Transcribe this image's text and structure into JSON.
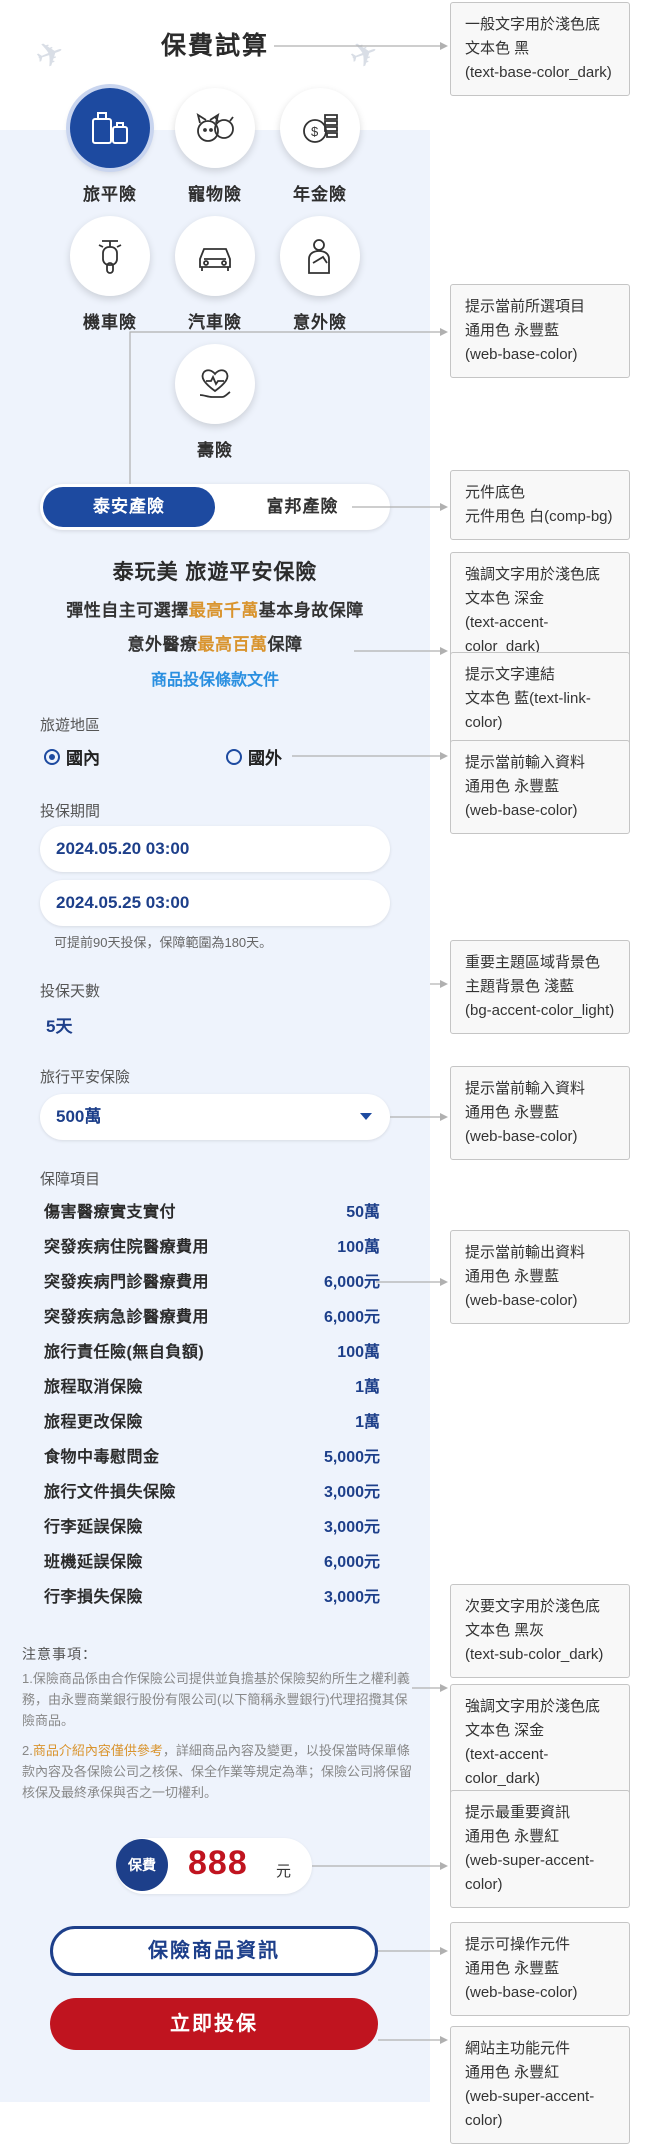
{
  "page": {
    "title": "保費試算"
  },
  "categories": [
    {
      "label": "旅平險",
      "icon": "luggage-icon",
      "active": true
    },
    {
      "label": "寵物險",
      "icon": "pet-icon",
      "active": false
    },
    {
      "label": "年金險",
      "icon": "coins-icon",
      "active": false
    },
    {
      "label": "機車險",
      "icon": "scooter-icon",
      "active": false
    },
    {
      "label": "汽車險",
      "icon": "car-icon",
      "active": false
    },
    {
      "label": "意外險",
      "icon": "accident-icon",
      "active": false
    },
    {
      "label": "壽險",
      "icon": "heart-hand-icon",
      "active": false
    }
  ],
  "insurer_toggle": {
    "selected": "泰安產險",
    "other": "富邦產險"
  },
  "product": {
    "title": "泰玩美 旅遊平安保險",
    "line1_pre": "彈性自主可選擇",
    "line1_highlight": "最高千萬",
    "line1_post": "基本身故保障",
    "line2_pre": "意外醫療",
    "line2_highlight": "最高百萬",
    "line2_post": "保障",
    "terms_link": "商品投保條款文件"
  },
  "form": {
    "region_label": "旅遊地區",
    "region_options": [
      "國內",
      "國外"
    ],
    "region_selected": "國內",
    "period_label": "投保期間",
    "start": "2024.05.20 03:00",
    "end": "2024.05.25 03:00",
    "period_hint": "可提前90天投保，保障範圍為180天。",
    "days_label": "投保天數",
    "days_value": "5天",
    "plan_label": "旅行平安保險",
    "plan_value": "500萬"
  },
  "coverage": {
    "label": "保障項目",
    "items": [
      {
        "name": "傷害醫療實支實付",
        "value": "50萬"
      },
      {
        "name": "突發疾病住院醫療費用",
        "value": "100萬"
      },
      {
        "name": "突發疾病門診醫療費用",
        "value": "6,000元"
      },
      {
        "name": "突發疾病急診醫療費用",
        "value": "6,000元"
      },
      {
        "name": "旅行責任險(無自負額)",
        "value": "100萬"
      },
      {
        "name": "旅程取消保險",
        "value": "1萬"
      },
      {
        "name": "旅程更改保險",
        "value": "1萬"
      },
      {
        "name": "食物中毒慰問金",
        "value": "5,000元"
      },
      {
        "name": "旅行文件損失保險",
        "value": "3,000元"
      },
      {
        "name": "行李延誤保險",
        "value": "3,000元"
      },
      {
        "name": "班機延誤保險",
        "value": "6,000元"
      },
      {
        "name": "行李損失保險",
        "value": "3,000元"
      }
    ]
  },
  "notes": {
    "title": "注意事項：",
    "note1_num": "1.",
    "note1": "保險商品係由合作保險公司提供並負擔基於保險契約所生之權利義務，由永豐商業銀行股份有限公司(以下簡稱永豐銀行)代理招攬其保險商品。",
    "note2_num": "2.",
    "note2_lead": "商品介紹內容僅供參考",
    "note2": "，詳細商品內容及變更，以投保當時保單條款內容及各保險公司之核保、保全作業等規定為準；保險公司將保留核保及最終承保與否之一切權利。"
  },
  "premium": {
    "badge": "保費",
    "amount": "888",
    "unit": "元"
  },
  "buttons": {
    "info": "保險商品資訊",
    "apply": "立即投保"
  },
  "annotations": [
    "一般文字用於淺色底\n文本色 黑\n(text-base-color_dark)",
    "提示當前所選項目\n通用色 永豐藍\n(web-base-color)",
    "元件底色\n元件用色 白(comp-bg)",
    "強調文字用於淺色底\n文本色 深金\n(text-accent-color_dark)",
    "提示文字連結\n文本色 藍(text-link-color)",
    "提示當前輸入資料\n通用色 永豐藍\n(web-base-color)",
    "重要主題區域背景色\n主題背景色 淺藍\n(bg-accent-color_light)",
    "提示當前輸入資料\n通用色 永豐藍\n(web-base-color)",
    "提示當前輸出資料\n通用色 永豐藍\n(web-base-color)",
    "次要文字用於淺色底\n文本色 黑灰\n(text-sub-color_dark)",
    "強調文字用於淺色底\n文本色 深金\n(text-accent-color_dark)",
    "提示最重要資訊\n通用色 永豐紅\n(web-super-accent-color)",
    "提示可操作元件\n通用色 永豐藍\n(web-base-color)",
    "網站主功能元件\n通用色 永豐紅\n(web-super-accent-color)"
  ],
  "colors": {
    "base_blue": "#1d4aa0",
    "deep_gold": "#d9942e",
    "link_blue": "#2a8fe0",
    "super_red": "#c0141f",
    "light_blue_bg": "#eef3fc"
  }
}
